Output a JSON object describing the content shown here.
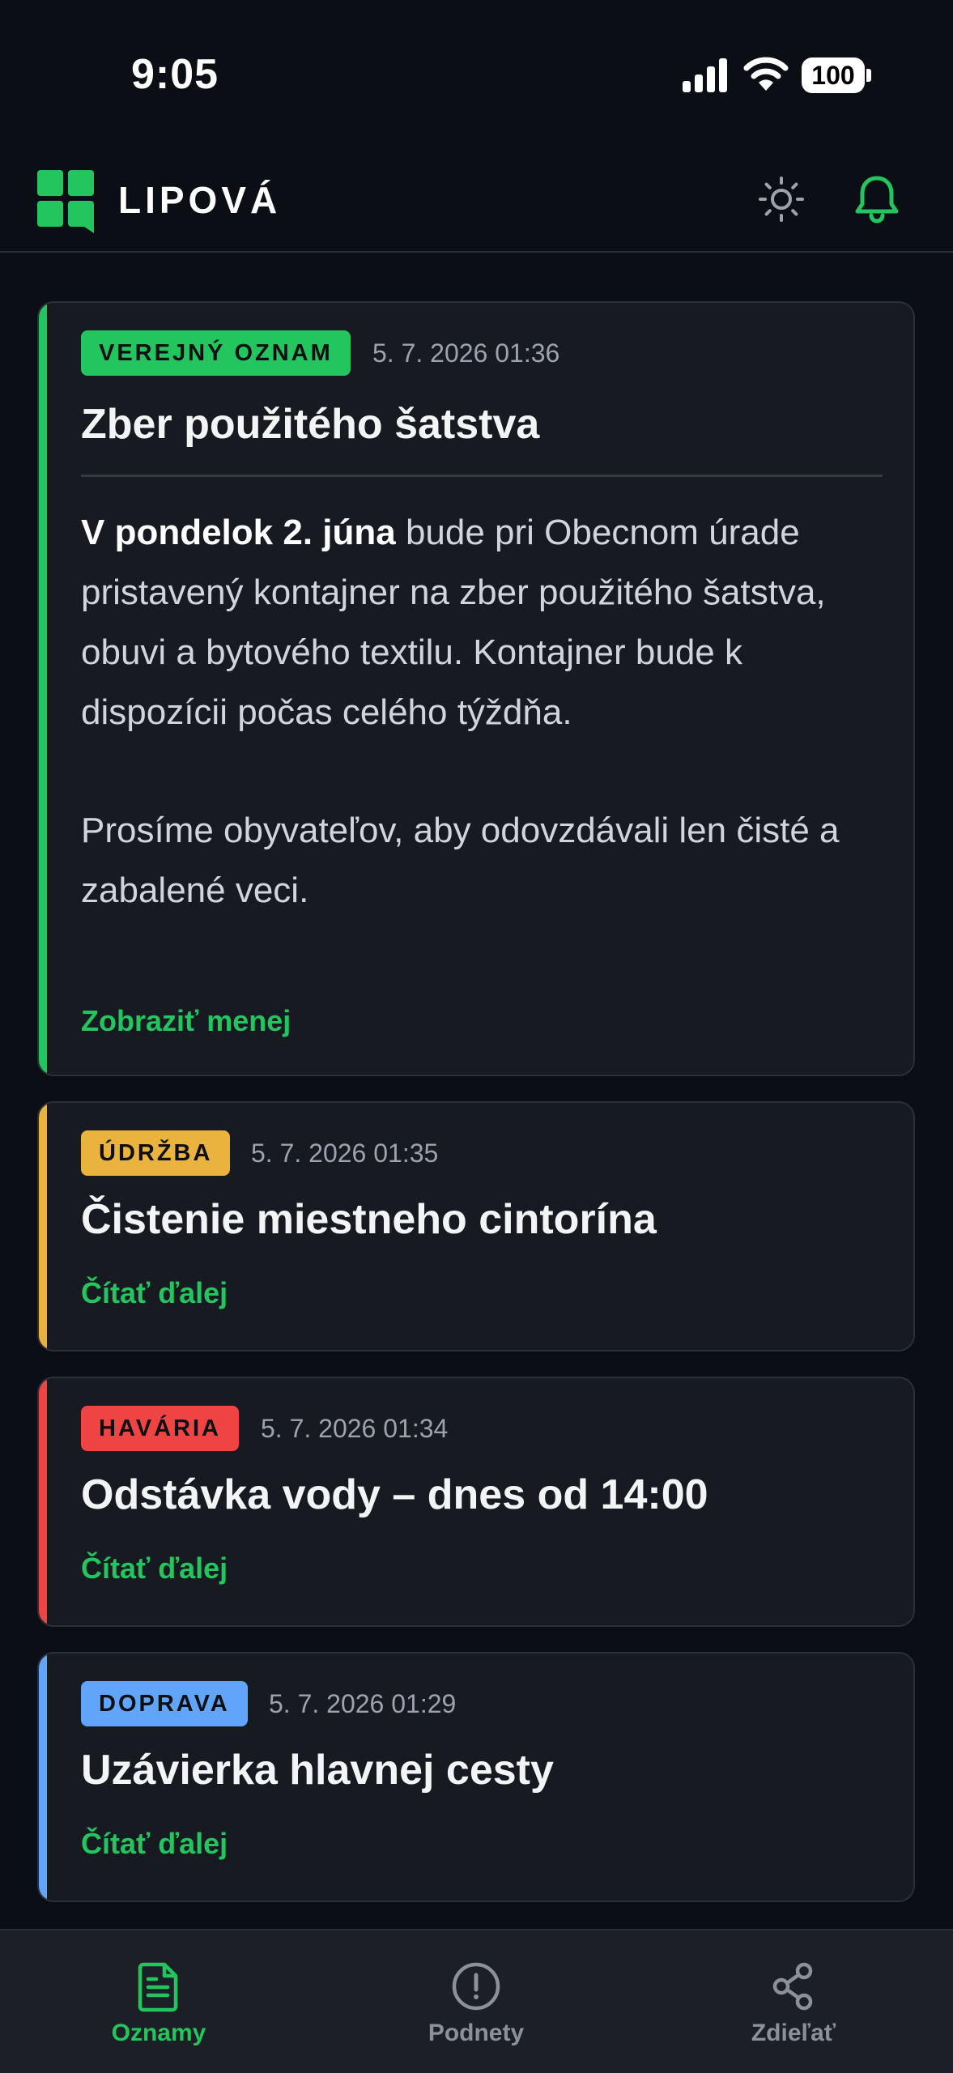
{
  "status_bar": {
    "time": "9:05",
    "battery": "100"
  },
  "header": {
    "title": "LIPOVÁ",
    "brand_color": "#22c55e"
  },
  "posts": [
    {
      "category": "VEREJNÝ OZNAM",
      "category_color": "#22c55e",
      "date": "5. 7. 2026 01:36",
      "title": "Zber použitého šatstva",
      "body_bold": "V pondelok 2. júna",
      "body_text": " bude pri Obecnom úrade pristavený kontajner na zber použitého šatstva, obuvi a bytového textilu. Kontajner bude k dispozícii počas celého týždňa.",
      "body_text_2": "Prosíme obyvateľov, aby odovzdávali len čisté a zabalené veci.",
      "link": "Zobraziť menej"
    },
    {
      "category": "ÚDRŽBA",
      "category_color": "#eab33e",
      "date": "5. 7. 2026 01:35",
      "title": "Čistenie miestneho cintorína",
      "link": "Čítať ďalej"
    },
    {
      "category": "HAVÁRIA",
      "category_color": "#ef4444",
      "date": "5. 7. 2026 01:34",
      "title": "Odstávka vody – dnes od 14:00",
      "link": "Čítať ďalej"
    },
    {
      "category": "DOPRAVA",
      "category_color": "#60a5fa",
      "date": "5. 7. 2026 01:29",
      "title": "Uzávierka hlavnej cesty",
      "link": "Čítať ďalej"
    }
  ],
  "nav": {
    "items": [
      {
        "label": "Oznamy",
        "icon": "document-icon",
        "active": true
      },
      {
        "label": "Podnety",
        "icon": "alert-circle-icon",
        "active": false
      },
      {
        "label": "Zdieľať",
        "icon": "share-icon",
        "active": false
      }
    ],
    "active_color": "#22c55e",
    "inactive_color": "#8b9099"
  }
}
